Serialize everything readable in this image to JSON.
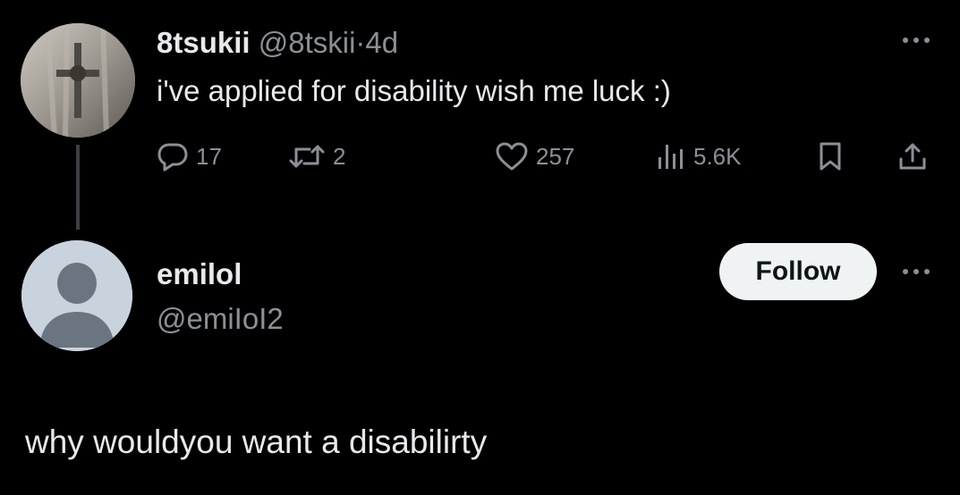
{
  "original_tweet": {
    "display_name": "8tsukii",
    "handle": "@8tskii",
    "separator": "·",
    "time": "4d",
    "text": "i've applied for disability wish me luck :)",
    "stats": {
      "replies": "17",
      "retweets": "2",
      "likes": "257",
      "views": "5.6K"
    },
    "icons": [
      "reply-icon",
      "retweet-icon",
      "like-icon",
      "views-icon",
      "bookmark-icon",
      "share-icon",
      "more-icon"
    ]
  },
  "reply": {
    "display_name": "emilol",
    "handle": "@emiIoI2",
    "follow_label": "Follow",
    "text": "why wouldyou want a disabilirty"
  },
  "colors": {
    "background": "#000000",
    "text": "#e7e9ea",
    "muted": "#8b9097",
    "follow_button_bg": "#eff3f4",
    "follow_button_text": "#0f1419"
  }
}
